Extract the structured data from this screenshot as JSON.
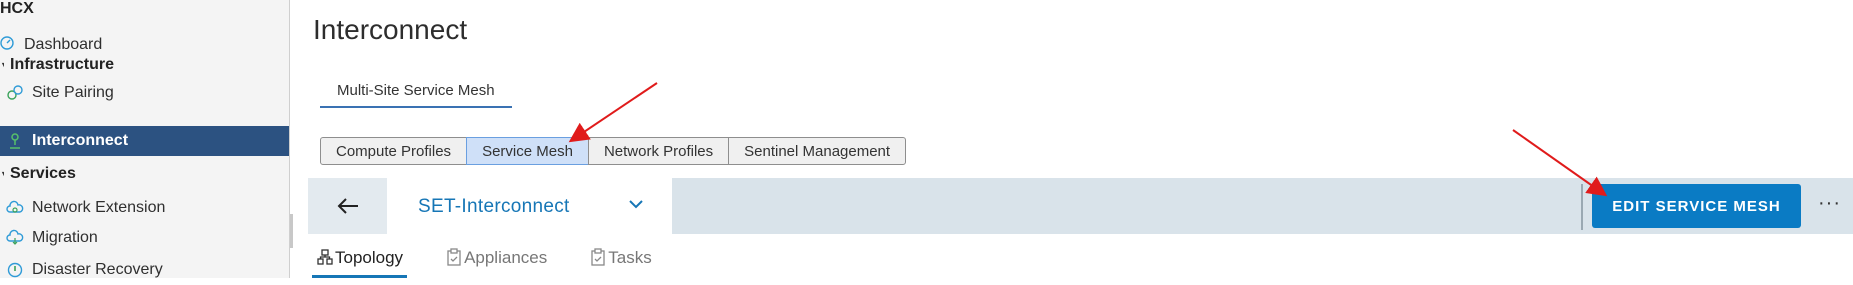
{
  "sidebar": {
    "app_title": "HCX",
    "items": [
      {
        "label": "Dashboard",
        "icon": "dashboard-icon"
      },
      {
        "label": "Infrastructure",
        "section": true
      },
      {
        "label": "Site Pairing",
        "icon": "link-icon"
      },
      {
        "label": "Interconnect",
        "icon": "network-icon",
        "active": true
      },
      {
        "label": "Services",
        "section": true
      },
      {
        "label": "Network Extension",
        "icon": "cloud-icon"
      },
      {
        "label": "Migration",
        "icon": "cloud-migrate-icon"
      },
      {
        "label": "Disaster Recovery",
        "icon": "recovery-icon"
      }
    ]
  },
  "main": {
    "title": "Interconnect",
    "top_tab": "Multi-Site Service Mesh",
    "segments": [
      {
        "label": "Compute Profiles"
      },
      {
        "label": "Service Mesh",
        "selected": true
      },
      {
        "label": "Network Profiles"
      },
      {
        "label": "Sentinel Management"
      }
    ],
    "mesh_bar": {
      "selected_mesh": "SET-Interconnect",
      "edit_button": "EDIT SERVICE MESH",
      "more_label": "···"
    },
    "tabs": [
      {
        "label": "Topology",
        "icon": "topology-icon",
        "active": true
      },
      {
        "label": "Appliances",
        "icon": "clipboard-icon"
      },
      {
        "label": "Tasks",
        "icon": "tasks-icon"
      }
    ]
  },
  "colors": {
    "sidebar_active": "#2c5281",
    "accent_blue": "#1676b6",
    "edit_button": "#0a7bc4",
    "annotation_arrow": "#e01b1b"
  }
}
